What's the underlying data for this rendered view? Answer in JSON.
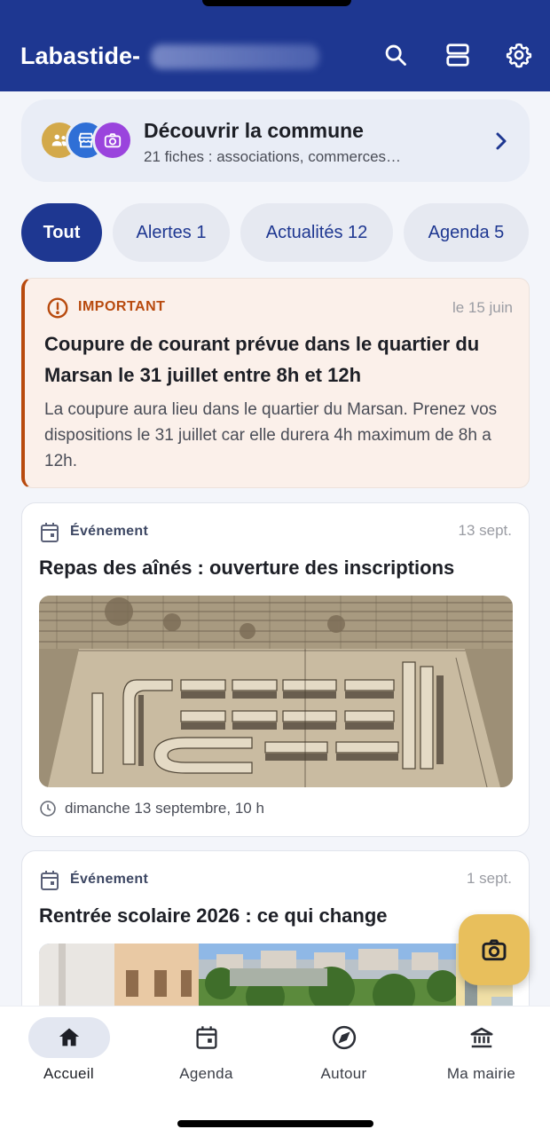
{
  "header": {
    "title": "Labastide-"
  },
  "discover": {
    "title": "Découvrir la commune",
    "subtitle": "21 fiches : associations, commerces…"
  },
  "chips": [
    {
      "label": "Tout"
    },
    {
      "label": "Alertes 1"
    },
    {
      "label": "Actualités 12"
    },
    {
      "label": "Agenda 5"
    }
  ],
  "alert": {
    "label": "IMPORTANT",
    "date": "le 15 juin",
    "title": "Coupure de courant prévue dans le quartier du Marsan le 31 juillet entre 8h et 12h",
    "body": "La coupure aura lieu dans le quartier du Marsan. Prenez vos dispositions le 31 juillet car elle durera 4h maximum de 8h a 12h."
  },
  "cards": [
    {
      "type": "Événement",
      "date": "13 sept.",
      "title": "Repas des aînés : ouverture des inscriptions",
      "time": "dimanche 13 septembre, 10 h"
    },
    {
      "type": "Événement",
      "date": "1 sept.",
      "title": "Rentrée scolaire 2026 : ce qui change"
    }
  ],
  "nav": [
    {
      "label": "Accueil",
      "icon": "home-icon"
    },
    {
      "label": "Agenda",
      "icon": "calendar-icon"
    },
    {
      "label": "Autour",
      "icon": "compass-icon"
    },
    {
      "label": "Ma mairie",
      "icon": "town-hall-icon"
    }
  ],
  "colors": {
    "primary": "#1e3791",
    "alert": "#b84a0e",
    "fab": "#e8bf5c"
  }
}
